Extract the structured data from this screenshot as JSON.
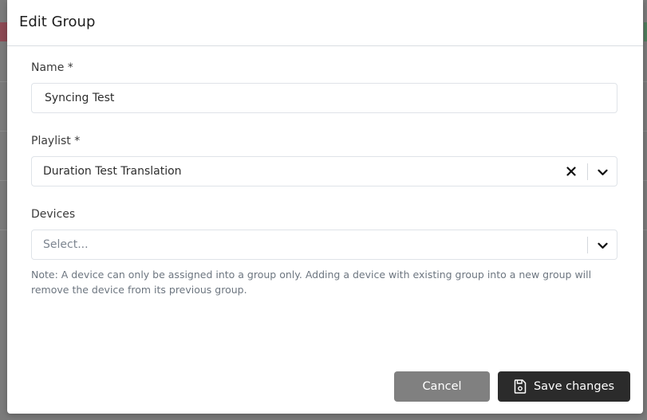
{
  "modal": {
    "title": "Edit Group"
  },
  "form": {
    "name": {
      "label": "Name *",
      "value": "Syncing Test"
    },
    "playlist": {
      "label": "Playlist *",
      "selected": "Duration Test Translation"
    },
    "devices": {
      "label": "Devices",
      "placeholder": "Select...",
      "note": "Note: A device can only be assigned into a group only. Adding a device with existing group into a new group will remove the device from its previous group."
    }
  },
  "footer": {
    "cancel_label": "Cancel",
    "save_label": "Save changes"
  },
  "icons": {
    "clear": "close-icon",
    "dropdown": "chevron-down-icon",
    "save": "save-icon"
  },
  "colors": {
    "cancel_button": "#808080",
    "save_button": "#2b2b2b",
    "backdrop": "#7b7b7b"
  }
}
